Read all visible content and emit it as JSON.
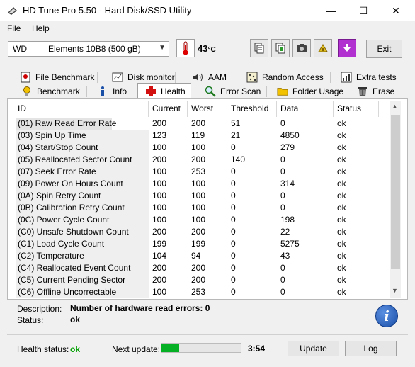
{
  "window": {
    "title": "HD Tune Pro 5.50 - Hard Disk/SSD Utility",
    "minimize_glyph": "—",
    "maximize_glyph": "☐",
    "close_glyph": "✕"
  },
  "menu": {
    "file": "File",
    "help": "Help"
  },
  "toolbar": {
    "drive_vendor": "WD",
    "drive_model": "Elements 10B8 (500 gB)",
    "temperature": "43",
    "temperature_unit": "°C",
    "exit_label": "Exit",
    "icons": [
      "copy-info-icon",
      "copy-screen-icon",
      "camera-icon",
      "options-icon",
      "save-icon"
    ]
  },
  "tabs_top": [
    {
      "label": "File Benchmark",
      "icon": "file-benchmark-icon"
    },
    {
      "label": "Disk monitor",
      "icon": "disk-monitor-icon"
    },
    {
      "label": "AAM",
      "icon": "speaker-icon"
    },
    {
      "label": "Random Access",
      "icon": "random-access-icon"
    },
    {
      "label": "Extra tests",
      "icon": "extra-tests-icon"
    }
  ],
  "tabs_bottom": [
    {
      "label": "Benchmark",
      "icon": "benchmark-icon"
    },
    {
      "label": "Info",
      "icon": "info-icon"
    },
    {
      "label": "Health",
      "icon": "health-icon",
      "active": true
    },
    {
      "label": "Error Scan",
      "icon": "error-scan-icon"
    },
    {
      "label": "Folder Usage",
      "icon": "folder-icon"
    },
    {
      "label": "Erase",
      "icon": "trash-icon"
    }
  ],
  "table": {
    "columns": [
      "ID",
      "Current",
      "Worst",
      "Threshold",
      "Data",
      "Status"
    ],
    "rows": [
      [
        "(01) Raw Read Error Rate",
        "200",
        "200",
        "51",
        "0",
        "ok"
      ],
      [
        "(03) Spin Up Time",
        "123",
        "119",
        "21",
        "4850",
        "ok"
      ],
      [
        "(04) Start/Stop Count",
        "100",
        "100",
        "0",
        "279",
        "ok"
      ],
      [
        "(05) Reallocated Sector Count",
        "200",
        "200",
        "140",
        "0",
        "ok"
      ],
      [
        "(07) Seek Error Rate",
        "100",
        "253",
        "0",
        "0",
        "ok"
      ],
      [
        "(09) Power On Hours Count",
        "100",
        "100",
        "0",
        "314",
        "ok"
      ],
      [
        "(0A) Spin Retry Count",
        "100",
        "100",
        "0",
        "0",
        "ok"
      ],
      [
        "(0B) Calibration Retry Count",
        "100",
        "100",
        "0",
        "0",
        "ok"
      ],
      [
        "(0C) Power Cycle Count",
        "100",
        "100",
        "0",
        "198",
        "ok"
      ],
      [
        "(C0) Unsafe Shutdown Count",
        "200",
        "200",
        "0",
        "22",
        "ok"
      ],
      [
        "(C1) Load Cycle Count",
        "199",
        "199",
        "0",
        "5275",
        "ok"
      ],
      [
        "(C2) Temperature",
        "104",
        "94",
        "0",
        "43",
        "ok"
      ],
      [
        "(C4) Reallocated Event Count",
        "200",
        "200",
        "0",
        "0",
        "ok"
      ],
      [
        "(C5) Current Pending Sector",
        "200",
        "200",
        "0",
        "0",
        "ok"
      ],
      [
        "(C6) Offline Uncorrectable",
        "100",
        "253",
        "0",
        "0",
        "ok"
      ]
    ]
  },
  "details": {
    "description_label": "Description:",
    "description_value": "Number of hardware read errors: 0",
    "status_label": "Status:",
    "status_value": "ok"
  },
  "footer": {
    "health_label": "Health status:",
    "health_value": "ok",
    "next_update_label": "Next update:",
    "next_update_progress": 0.22,
    "next_update_time": "3:54",
    "update_label": "Update",
    "log_label": "Log"
  },
  "colors": {
    "ok_green": "#00a000",
    "progress_green": "#06b025",
    "info_blue": "#1a4fa8"
  }
}
